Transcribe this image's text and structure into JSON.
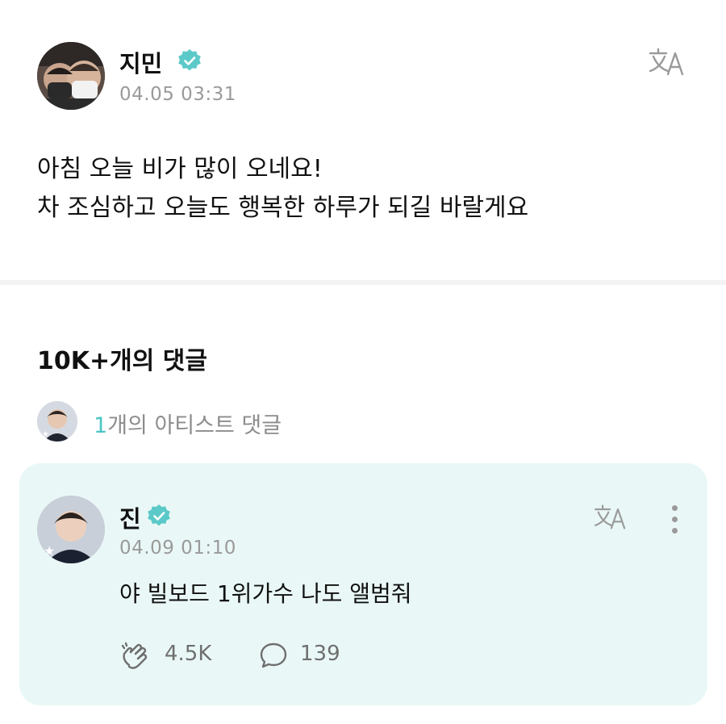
{
  "post": {
    "author": "지민",
    "timestamp": "04.05 03:31",
    "body_lines": [
      "아침 오늘 비가 많이 오네요!",
      "차 조심하고 오늘도 행복한 하루가 되길 바랄게요"
    ]
  },
  "comments": {
    "title": "10K+개의 댓글",
    "artist_count": "1",
    "artist_label": "개의 아티스트 댓글",
    "featured": {
      "author": "진",
      "timestamp": "04.09 01:10",
      "body": "야 빌보드 1위가수 나도 앨범줘",
      "likes": "4.5K",
      "replies": "139"
    }
  },
  "colors": {
    "accent": "#4cc4c4",
    "card_background": "#e9f8f6",
    "muted_text": "#9a9a9a"
  },
  "icons": [
    "verified-badge-icon",
    "translate-icon",
    "more-vertical-icon",
    "clap-icon",
    "comment-bubble-icon"
  ]
}
